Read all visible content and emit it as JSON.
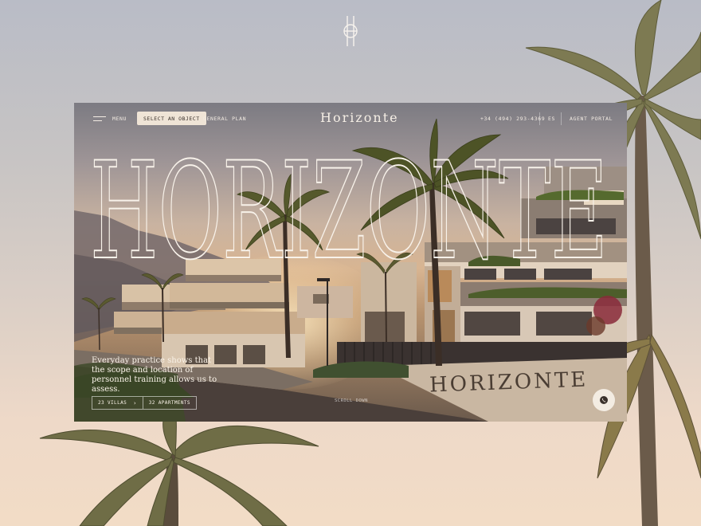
{
  "page": {
    "logo_monogram": "HORIZONTE"
  },
  "nav": {
    "menu_label": "MENU",
    "select_object_label": "SELECT AN OBJECT",
    "general_plan_label": "GENERAL PLAN",
    "brand": "Horizonte",
    "phone": "+34 (494) 293-4369",
    "language": "ES",
    "agent_portal_label": "AGENT PORTAL"
  },
  "hero": {
    "title": "HORIZONTE",
    "wall_sign": "HORIZONTE",
    "tagline": "Everyday practice shows that the scope and location of personnel training allows us to assess.",
    "villas_label": "23 VILLAS",
    "apartments_label": "32 APARTMENTS",
    "arrow_glyph": "›",
    "scroll_label": "SCROLL DOWN"
  },
  "icons": {
    "menu": "hamburger-icon",
    "whatsapp": "whatsapp-icon",
    "arrow": "chevron-right-icon"
  },
  "colors": {
    "accent_button": "#efe4d6",
    "text_light": "#f3ece4"
  }
}
